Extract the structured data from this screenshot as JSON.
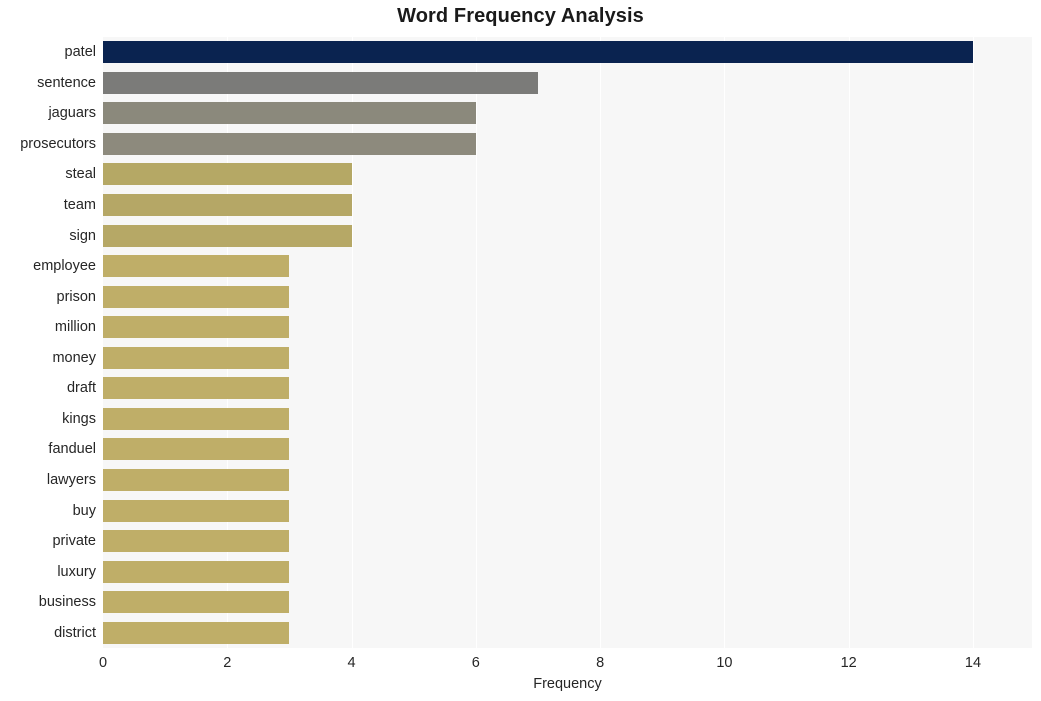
{
  "chart_data": {
    "type": "bar",
    "orientation": "horizontal",
    "title": "Word Frequency Analysis",
    "xlabel": "Frequency",
    "ylabel": "",
    "xlim": [
      0,
      14.95
    ],
    "xticks": [
      0,
      2,
      4,
      6,
      8,
      10,
      12,
      14
    ],
    "xtick_labels": [
      "0",
      "2",
      "4",
      "6",
      "8",
      "10",
      "12",
      "14"
    ],
    "grid": true,
    "grid_axis": "x",
    "legend": "none",
    "categories": [
      "patel",
      "sentence",
      "jaguars",
      "prosecutors",
      "steal",
      "team",
      "sign",
      "employee",
      "prison",
      "million",
      "money",
      "draft",
      "kings",
      "fanduel",
      "lawyers",
      "buy",
      "private",
      "luxury",
      "business",
      "district"
    ],
    "values": [
      14,
      7,
      6,
      6,
      4,
      4,
      4,
      3,
      3,
      3,
      3,
      3,
      3,
      3,
      3,
      3,
      3,
      3,
      3,
      3
    ],
    "bar_colors": [
      "#0a2350",
      "#7b7b79",
      "#8b897c",
      "#8d8a7d",
      "#b5a865",
      "#b5a766",
      "#b6a866",
      "#bfae68",
      "#bfae68",
      "#bfae68",
      "#bfae68",
      "#bfae68",
      "#bfae68",
      "#bfae68",
      "#bfae68",
      "#bfae68",
      "#bfae68",
      "#bfae68",
      "#bfae68",
      "#bfae68"
    ],
    "plot_background": "#f7f7f7",
    "figure_background": "#ffffff",
    "gridline_color": "#ffffff"
  }
}
